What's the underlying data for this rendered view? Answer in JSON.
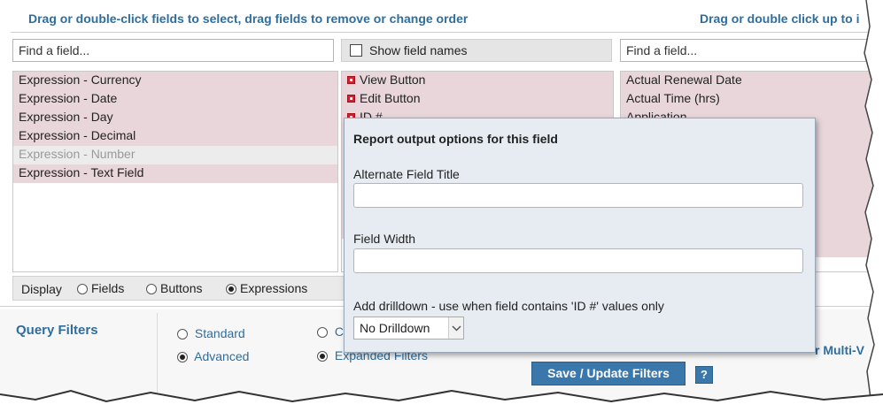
{
  "header": {
    "left_instruction": "Drag or double-click fields to select, drag fields to remove or change order",
    "right_instruction": "Drag or double click up to i"
  },
  "left_search": {
    "value": "",
    "placeholder": "Find a field..."
  },
  "show_names": {
    "label": "Show field names",
    "checked": false
  },
  "right_search": {
    "value": "",
    "placeholder": "Find a field..."
  },
  "available_fields": [
    {
      "label": "Expression - Currency",
      "enabled": true
    },
    {
      "label": "Expression - Date",
      "enabled": true
    },
    {
      "label": "Expression - Day",
      "enabled": true
    },
    {
      "label": "Expression - Decimal",
      "enabled": true
    },
    {
      "label": "Expression - Number",
      "enabled": false
    },
    {
      "label": "Expression - Text Field",
      "enabled": true
    }
  ],
  "selected_fields": [
    {
      "label": "View Button"
    },
    {
      "label": "Edit Button"
    },
    {
      "label": "ID #"
    }
  ],
  "right_fields": [
    {
      "label": "Actual Renewal Date"
    },
    {
      "label": "Actual Time (hrs)"
    },
    {
      "label": "Application"
    }
  ],
  "display": {
    "label": "Display",
    "options": [
      {
        "label": "Fields",
        "selected": false
      },
      {
        "label": "Buttons",
        "selected": false
      },
      {
        "label": "Expressions",
        "selected": true
      }
    ]
  },
  "query_filters": {
    "title": "Query Filters",
    "standard": "Standard",
    "advanced": "Advanced",
    "mode_selected": "Advanced",
    "option_partial": "C",
    "expanded": "Expanded Filters",
    "right_partial": "r Multi-V",
    "save_button": "Save / Update Filters",
    "help": "?"
  },
  "popup": {
    "title": "Report output options for this field",
    "alt_title_label": "Alternate Field Title",
    "alt_title_value": "",
    "width_label": "Field Width",
    "width_value": "",
    "drilldown_label": "Add drilldown - use when field contains 'ID #' values only",
    "drilldown_value": "No Drilldown"
  },
  "colors": {
    "header_blue": "#2e6e9e",
    "row_pink": "#e8d6da",
    "button_blue": "#3a77aa",
    "marker_red": "#d4202f"
  }
}
